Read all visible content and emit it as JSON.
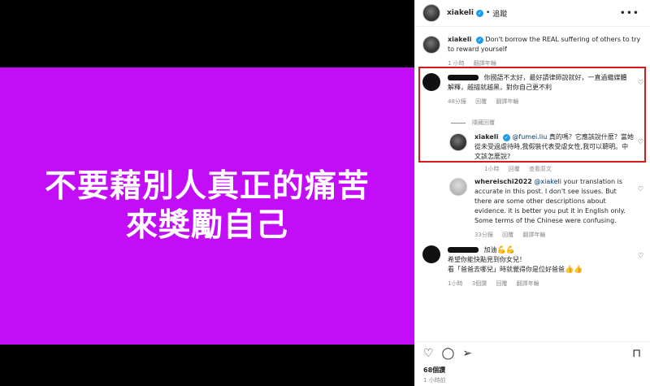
{
  "post": {
    "poster_lines": [
      "不要藉別人真正的痛苦",
      "來獎勵自己"
    ],
    "background_color": "#c30cf7"
  },
  "header": {
    "username": "xiakeli",
    "dot": "•",
    "follow_label": "追蹤",
    "more_icon": "more-icon"
  },
  "caption": {
    "username": "xiakeli",
    "text": "Don't borrow the REAL suffering of others to try to reward yourself",
    "time": "1 小時",
    "translate": "翻譯年輪"
  },
  "comment1": {
    "text": "你國語不太好，最好請律師說就好，一直過繼媒體解釋，越描就越黑，對你自己更不利",
    "time": "48分鐘",
    "reply": "回覆",
    "translate": "翻譯年輪"
  },
  "hide_replies": "隱藏回覆",
  "reply1": {
    "username": "xiakeli",
    "mention": "@fumei.liu",
    "text": "真的嗎？它應該說什麼？當她從未受過虐待時,我假裝代表受虐女性,我可以聰明。中文該怎麼說?",
    "time": "1小時",
    "reply": "回覆",
    "translate": "查看原文"
  },
  "reply2": {
    "username": "whereischi2022",
    "mention": "@xiakeli",
    "text": "your translation is accurate in this post. I don't see issues. But there are some other descriptions about evidence. it is better you put it in English only. Some terms of the Chinese were confusing.",
    "time": "33分鐘",
    "reply": "回覆",
    "translate": "翻譯年輪"
  },
  "comment2": {
    "line1": "加油",
    "line1_emoji": "💪💪",
    "line2": "希望你能快點見到你女兒！",
    "line3": "看「爸爸去哪兒」時就覺得你是位好爸爸",
    "line3_emoji": "👍👍",
    "time": "1小時",
    "likes": "3個讚",
    "reply": "回覆",
    "translate": "翻譯年輪"
  },
  "actions": {
    "like_icon": "heart-icon",
    "comment_icon": "comment-icon",
    "share_icon": "share-icon",
    "save_icon": "bookmark-icon",
    "likes": "68個讚",
    "time": "1 小時前"
  }
}
